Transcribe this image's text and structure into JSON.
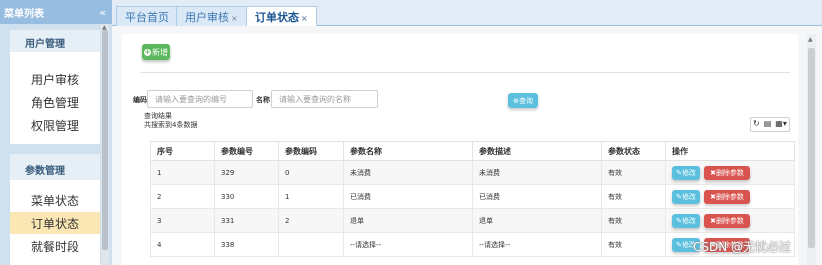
{
  "sidebar": {
    "title": "菜单列表",
    "collapse_icon": "«",
    "groups": [
      {
        "title": "用户管理",
        "items": [
          "用户审核",
          "角色管理",
          "权限管理"
        ]
      },
      {
        "title": "参数管理",
        "items": [
          "菜单状态",
          "订单状态",
          "就餐时段"
        ]
      }
    ],
    "active_item": "订单状态"
  },
  "tabs": [
    {
      "label": "平台首页",
      "closable": false
    },
    {
      "label": "用户审核",
      "closable": true
    },
    {
      "label": "订单状态",
      "closable": true,
      "active": true
    }
  ],
  "toolbar": {
    "add_label": "新增"
  },
  "search": {
    "code_label": "编码",
    "code_placeholder": "请输入要查询的编号",
    "name_label": "名称",
    "name_placeholder": "请输入要查询的名称",
    "button_label": "查询"
  },
  "results": {
    "title": "查询结果",
    "summary": "共搜索到4条数据"
  },
  "table": {
    "columns": [
      "序号",
      "参数编号",
      "参数编码",
      "参数名称",
      "参数描述",
      "参数状态",
      "操作"
    ],
    "rows": [
      [
        "1",
        "329",
        "0",
        "未消费",
        "未消费",
        "有效"
      ],
      [
        "2",
        "330",
        "1",
        "已消费",
        "已消费",
        "有效"
      ],
      [
        "3",
        "331",
        "2",
        "退单",
        "退单",
        "有效"
      ],
      [
        "4",
        "338",
        "",
        "--请选择--",
        "--请选择--",
        "有效"
      ]
    ],
    "edit_label": "修改",
    "delete_label": "删除参数"
  },
  "watermark": "CSDN @无忧必过",
  "colors": {
    "sidebar_header": "#97bde0",
    "active_item": "#fbe7b4",
    "add_button": "#5cb85c",
    "search_button": "#5bc0de",
    "delete_button": "#d9534f"
  }
}
